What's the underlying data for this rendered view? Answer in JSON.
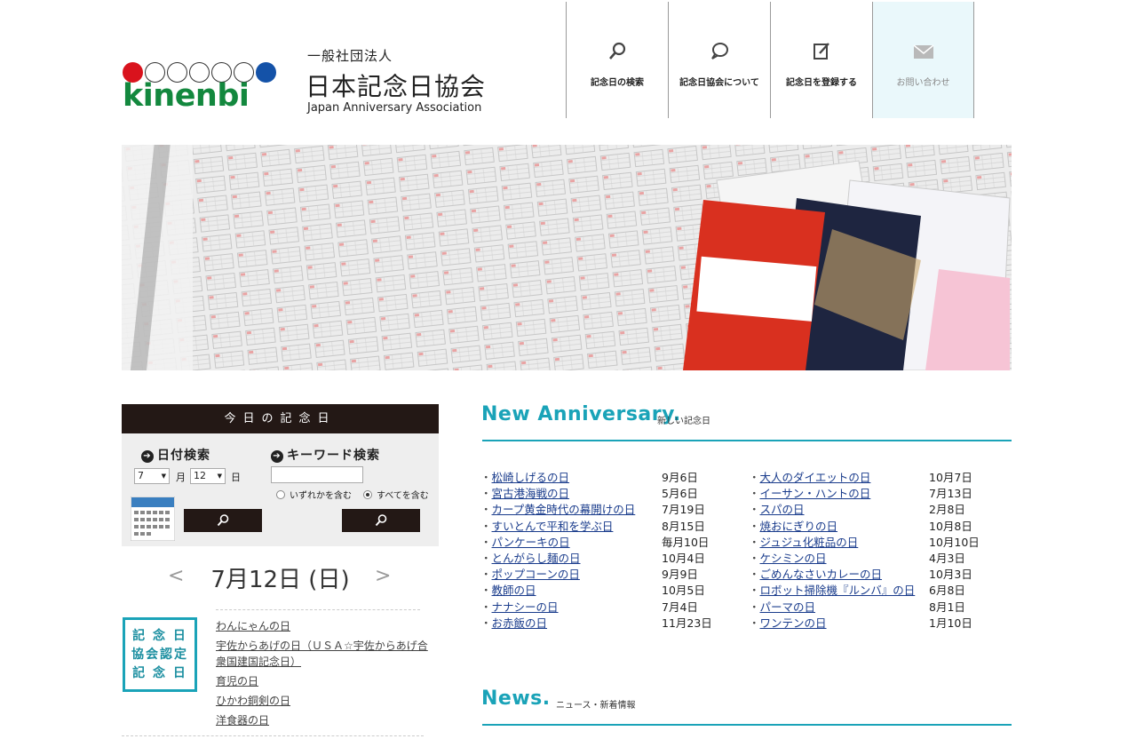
{
  "header": {
    "logo_text": "kinenbi",
    "org_type": "一般社団法人",
    "org_name": "日本記念日協会",
    "org_en": "Japan Anniversary Association"
  },
  "nav": [
    {
      "label": "記念日の検索",
      "icon": "search-icon"
    },
    {
      "label": "記念日協会について",
      "icon": "speech-bubble-icon"
    },
    {
      "label": "記念日を登録する",
      "icon": "edit-icon"
    },
    {
      "label": "お問い合わせ",
      "icon": "mail-icon"
    }
  ],
  "today_panel": {
    "title": "今日の記念日",
    "date_search_title": "日付検索",
    "keyword_search_title": "キーワード検索",
    "month_value": "7",
    "month_unit": "月",
    "day_value": "12",
    "day_unit": "日",
    "radio_any": "いずれかを含む",
    "radio_all": "すべてを含む",
    "radio_selected": "all",
    "current_date": "7月12日 (日)",
    "prev": "<",
    "next": ">",
    "badge": [
      "記 念 日",
      "協会認定",
      "記 念 日"
    ],
    "items": [
      "わんにゃんの日",
      "宇佐からあげの日（ＵＳＡ☆宇佐からあげ合衆国建国記念日）",
      "育児の日",
      "ひかわ銅剣の日",
      "洋食器の日"
    ]
  },
  "new_anniversary": {
    "title": "New Anniversary.",
    "subtitle": "新しい記念日",
    "left": [
      {
        "name": "松崎しげるの日",
        "date": "9月6日"
      },
      {
        "name": "宮古港海戦の日",
        "date": "5月6日"
      },
      {
        "name": "カープ黄金時代の幕開けの日",
        "date": "7月19日"
      },
      {
        "name": "すいとんで平和を学ぶ日",
        "date": "8月15日"
      },
      {
        "name": "パンケーキの日",
        "date": "毎月10日"
      },
      {
        "name": "とんがらし麺の日",
        "date": "10月4日"
      },
      {
        "name": "ポップコーンの日",
        "date": "9月9日"
      },
      {
        "name": "教師の日",
        "date": "10月5日"
      },
      {
        "name": "ナナシーの日",
        "date": "7月4日"
      },
      {
        "name": "お赤飯の日",
        "date": "11月23日"
      }
    ],
    "right": [
      {
        "name": "大人のダイエットの日",
        "date": "10月7日"
      },
      {
        "name": "イーサン・ハントの日",
        "date": "7月13日"
      },
      {
        "name": "スパの日",
        "date": "2月8日"
      },
      {
        "name": "焼おにぎりの日",
        "date": "10月8日"
      },
      {
        "name": "ジュジュ化粧品の日",
        "date": "10月10日"
      },
      {
        "name": "ケシミンの日",
        "date": "4月3日"
      },
      {
        "name": "ごめんなさいカレーの日",
        "date": "10月3日"
      },
      {
        "name": "ロボット掃除機『ルンバ』の日",
        "date": "6月8日"
      },
      {
        "name": "パーマの日",
        "date": "8月1日"
      },
      {
        "name": "ワンテンの日",
        "date": "1月10日"
      }
    ]
  },
  "news": {
    "title": "News.",
    "subtitle": "ニュース・新着情報"
  },
  "colors": {
    "accent": "#1aa3b8",
    "dark": "#231815",
    "logo_green": "#13883e",
    "logo_red": "#d9131d",
    "logo_blue": "#1452a8"
  }
}
